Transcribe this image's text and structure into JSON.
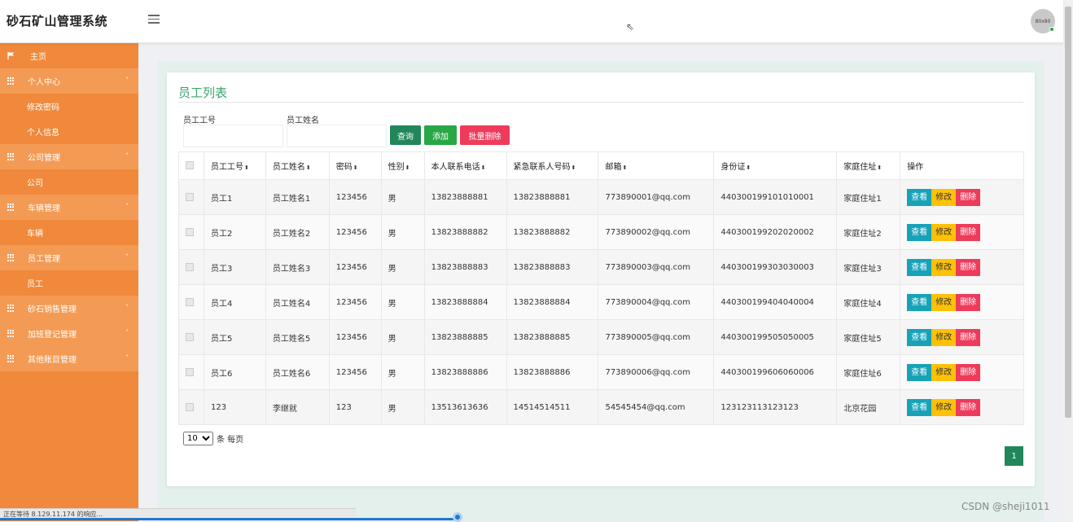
{
  "app": {
    "title": "砂石矿山管理系统",
    "avatar_text": "80x80"
  },
  "sidebar": {
    "home": "主页",
    "groups": [
      {
        "label": "个人中心",
        "caret": "˄",
        "items": [
          "修改密码",
          "个人信息"
        ]
      },
      {
        "label": "公司管理",
        "caret": "˄",
        "items": [
          "公司"
        ]
      },
      {
        "label": "车辆管理",
        "caret": "˄",
        "items": [
          "车辆"
        ]
      },
      {
        "label": "员工管理",
        "caret": "˄",
        "items": [
          "员工"
        ]
      },
      {
        "label": "砂石销售管理",
        "caret": "˅",
        "items": []
      },
      {
        "label": "加班登记管理",
        "caret": "˅",
        "items": []
      },
      {
        "label": "其他账目管理",
        "caret": "˅",
        "items": []
      }
    ]
  },
  "page": {
    "title": "员工列表",
    "filters": {
      "emp_no_label": "员工工号",
      "emp_no_value": "",
      "emp_name_label": "员工姓名",
      "emp_name_value": ""
    },
    "buttons": {
      "query": "查询",
      "add": "添加",
      "batch_delete": "批量删除"
    }
  },
  "table": {
    "headers": [
      "员工工号",
      "员工姓名",
      "密码",
      "性别",
      "本人联系电话",
      "紧急联系人号码",
      "邮箱",
      "身份证",
      "家庭住址",
      "操作"
    ],
    "sort_glyph": "⬍",
    "action_labels": {
      "view": "查看",
      "edit": "修改",
      "delete": "删除"
    },
    "rows": [
      [
        "员工1",
        "员工姓名1",
        "123456",
        "男",
        "13823888881",
        "13823888881",
        "773890001@qq.com",
        "440300199101010001",
        "家庭住址1"
      ],
      [
        "员工2",
        "员工姓名2",
        "123456",
        "男",
        "13823888882",
        "13823888882",
        "773890002@qq.com",
        "440300199202020002",
        "家庭住址2"
      ],
      [
        "员工3",
        "员工姓名3",
        "123456",
        "男",
        "13823888883",
        "13823888883",
        "773890003@qq.com",
        "440300199303030003",
        "家庭住址3"
      ],
      [
        "员工4",
        "员工姓名4",
        "123456",
        "男",
        "13823888884",
        "13823888884",
        "773890004@qq.com",
        "440300199404040004",
        "家庭住址4"
      ],
      [
        "员工5",
        "员工姓名5",
        "123456",
        "男",
        "13823888885",
        "13823888885",
        "773890005@qq.com",
        "440300199505050005",
        "家庭住址5"
      ],
      [
        "员工6",
        "员工姓名6",
        "123456",
        "男",
        "13823888886",
        "13823888886",
        "773890006@qq.com",
        "440300199606060006",
        "家庭住址6"
      ],
      [
        "123",
        "李继就",
        "123",
        "男",
        "13513613636",
        "14514514511",
        "54545454@qq.com",
        "123123113123123",
        "北京花园"
      ]
    ]
  },
  "pagination": {
    "page_size": "10",
    "page_size_suffix": "条 每页",
    "current_page": "1"
  },
  "status_bar": {
    "text": "正在等待 8.129.11.174 的响应..."
  },
  "watermark": "CSDN @sheji1011",
  "colors": {
    "sidebar": "#f0893b",
    "sidebar_group": "#f39b55",
    "title_green": "#3aa56b",
    "primary": "#21875b",
    "success": "#28a745",
    "danger": "#ee3b5b",
    "info": "#17a2b8",
    "warning": "#ffc107"
  }
}
